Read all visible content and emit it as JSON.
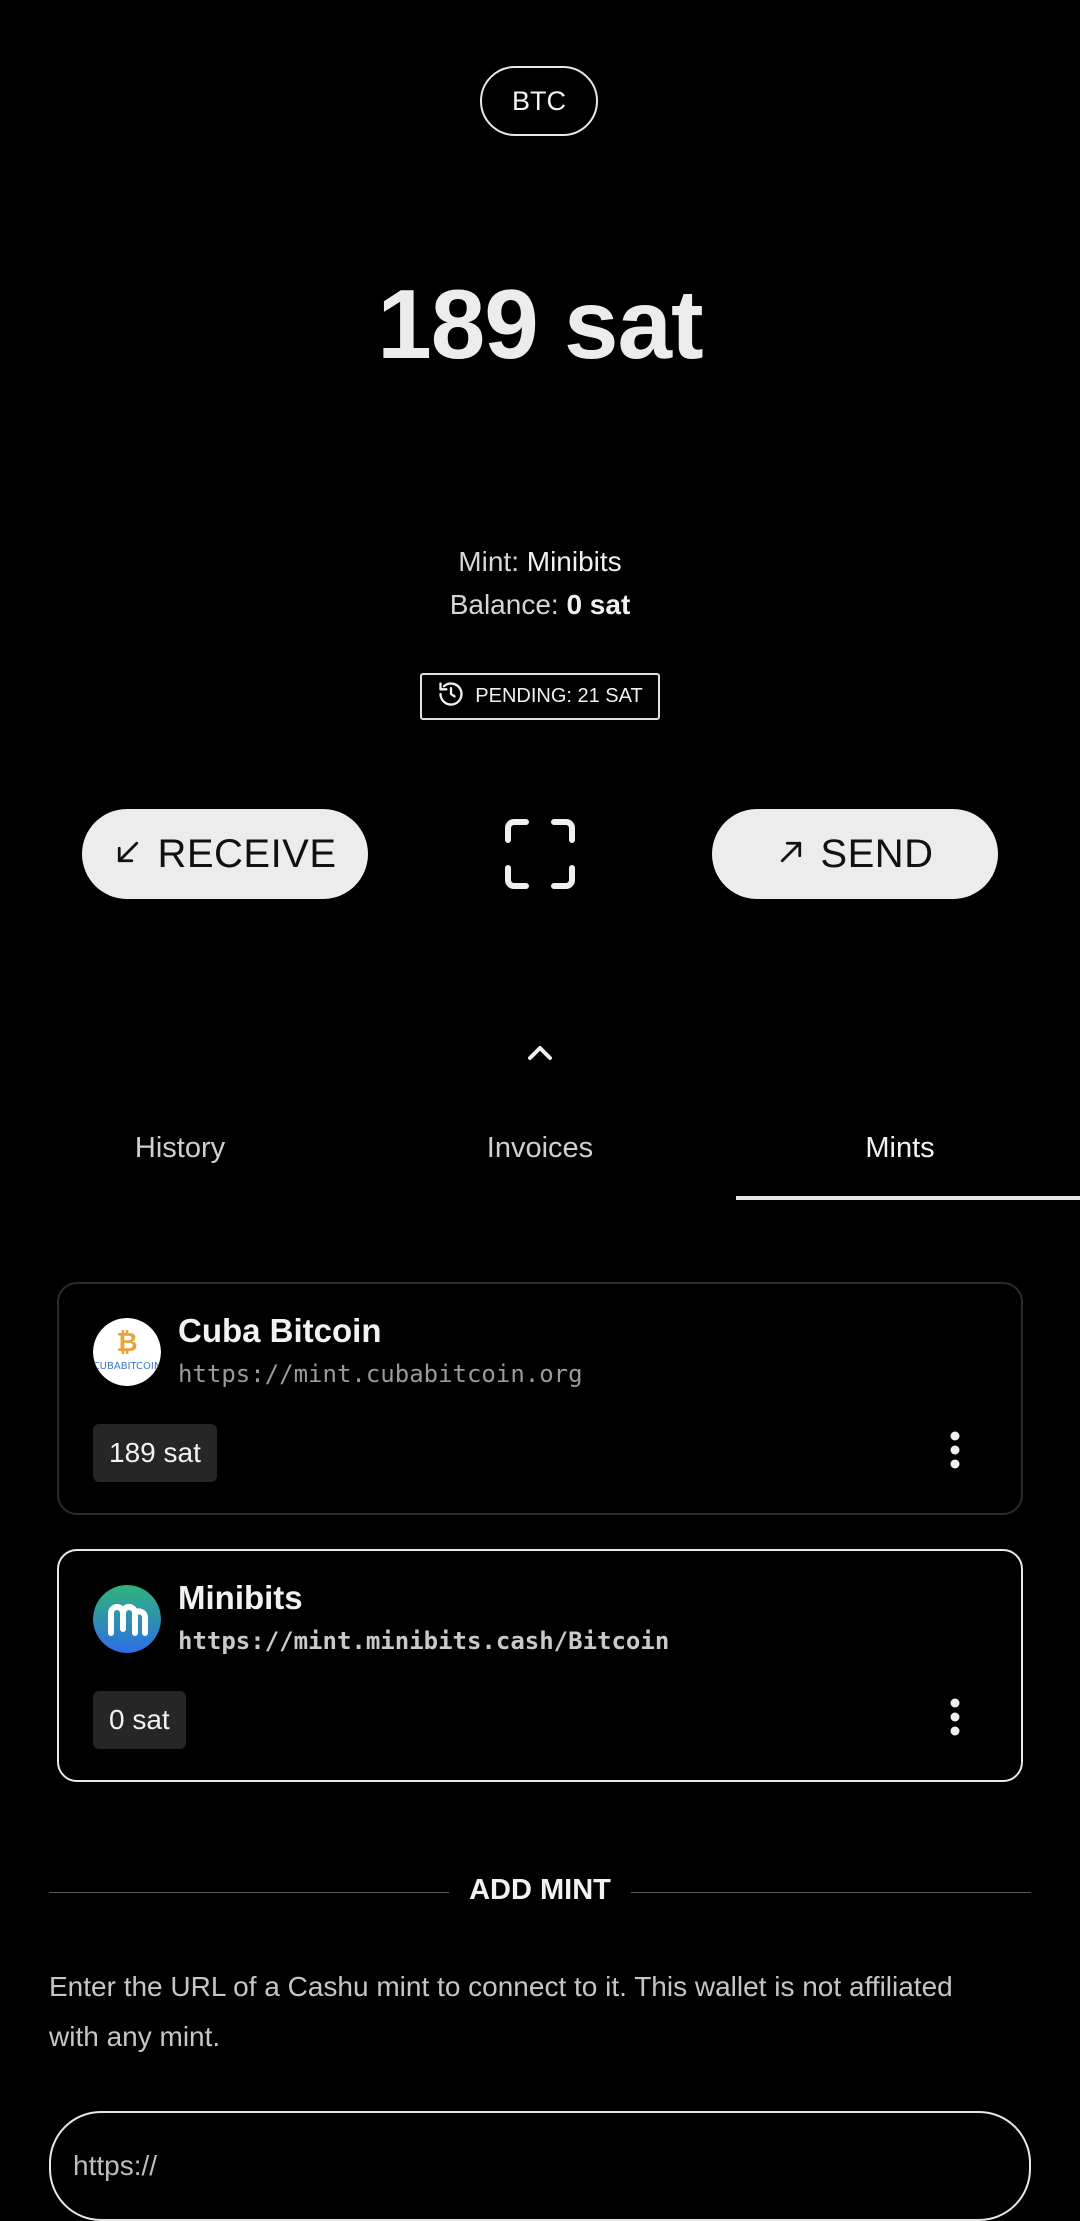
{
  "header": {
    "unit_label": "BTC"
  },
  "balance": {
    "amount": "189 sat"
  },
  "mint_info": {
    "mint_prefix": "Mint:",
    "mint_name": "Minibits",
    "balance_prefix": "Balance:",
    "balance_value": "0 sat"
  },
  "pending": {
    "label": "PENDING: 21 SAT"
  },
  "actions": {
    "receive_label": "RECEIVE",
    "send_label": "SEND"
  },
  "tabs": [
    {
      "label": "History",
      "active": false
    },
    {
      "label": "Invoices",
      "active": false
    },
    {
      "label": "Mints",
      "active": true
    }
  ],
  "mints": [
    {
      "name": "Cuba Bitcoin",
      "url": "https://mint.cubabitcoin.org",
      "amount": "189 sat",
      "selected": false
    },
    {
      "name": "Minibits",
      "url": "https://mint.minibits.cash/Bitcoin",
      "amount": "0 sat",
      "selected": true
    }
  ],
  "add_mint": {
    "title": "ADD MINT",
    "description": "Enter the URL of a Cashu mint to connect to it. This wallet is not affiliated with any mint.",
    "input_placeholder": "https://"
  },
  "colors": {
    "background": "#000000",
    "accent": "#ececec",
    "pill_text": "#111111",
    "amount_chip_bg": "#262626"
  },
  "icons": {
    "pending": "history-icon",
    "receive": "arrow-down-left-icon",
    "send": "arrow-up-right-icon",
    "scan": "scan-icon",
    "collapse": "chevron-up-icon",
    "menu": "more-vertical-icon"
  }
}
